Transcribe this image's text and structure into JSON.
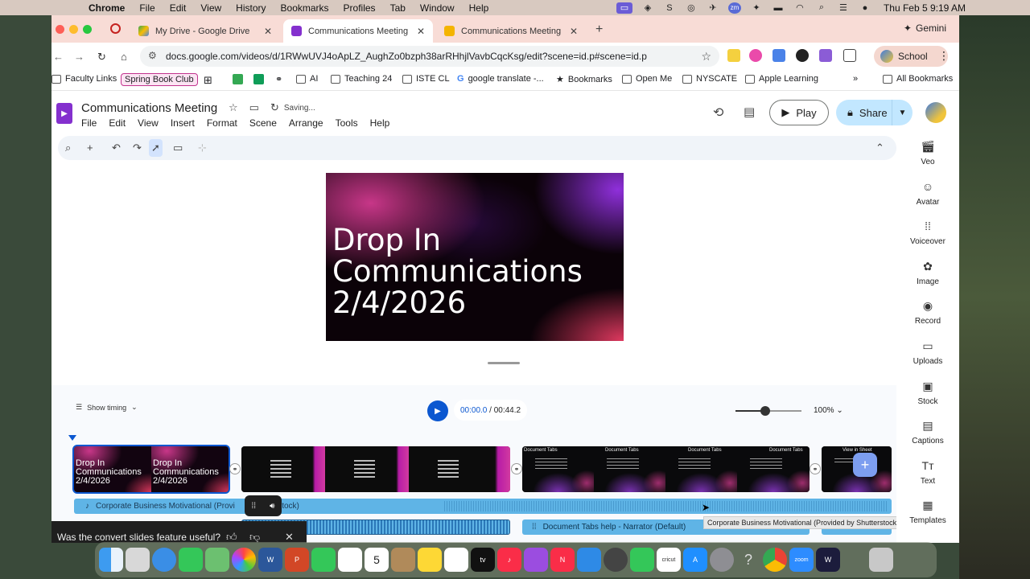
{
  "menubar": {
    "app": "Chrome",
    "menus": [
      "File",
      "Edit",
      "View",
      "History",
      "Bookmarks",
      "Profiles",
      "Tab",
      "Window",
      "Help"
    ],
    "clock": "Thu Feb 5  9:19 AM"
  },
  "tabs": [
    {
      "title": "My Drive - Google Drive",
      "color": "#34a853"
    },
    {
      "title": "Communications Meeting - G",
      "color": "#8430ce"
    },
    {
      "title": "Communications Meeting - G",
      "color": "#f4b400"
    }
  ],
  "gemini_label": "Gemini",
  "url": "docs.google.com/videos/d/1RWwUVJ4oApLZ_AughZo0bzph38arRHhjlVavbCqcKsg/edit?scene=id.p#scene=id.p",
  "profile_label": "School",
  "bookmarks": {
    "items": [
      "Faculty Links",
      "Spring Book Club",
      "AI",
      "Teaching 24",
      "ISTE CL",
      "google translate -...",
      "Bookmarks",
      "Open Me",
      "NYSCATE",
      "Apple Learning"
    ],
    "all_label": "All Bookmarks"
  },
  "doc": {
    "title": "Communications Meeting",
    "status": "Saving...",
    "menu": [
      "File",
      "Edit",
      "View",
      "Insert",
      "Format",
      "Scene",
      "Arrange",
      "Tools",
      "Help"
    ],
    "play_label": "Play",
    "share_label": "Share"
  },
  "slide": {
    "text": "Drop In\nCommunications\n2/4/2026"
  },
  "timeline": {
    "show_timing": "Show timing",
    "current_time": "00:00.0",
    "total_time": "/ 00:44.2",
    "zoom": "100%",
    "title_clip_text": "Drop In\nCommunications\n2/4/2026",
    "doc_tabs_label": "Document Tabs",
    "last_clip_label": "View in Sheet",
    "music_track": "Corporate Business Motivational (Provided by Shutterstock)",
    "music_track_visible": "Corporate Business Motivational (Provi",
    "music_track_tail": "rstock)",
    "narrator_clip": "Document Tabs help - Narrator (Default)",
    "tooltip": "Corporate Business Motivational (Provided by Shutterstock)"
  },
  "feedback": {
    "question": "Was the convert slides feature useful?"
  },
  "sidepanel": [
    "Veo",
    "Avatar",
    "Voiceover",
    "Image",
    "Record",
    "Uploads",
    "Stock",
    "Captions",
    "Text",
    "Templates"
  ],
  "colors": {
    "accent": "#0b57d0",
    "share_bg": "#c2e7ff",
    "track_blue": "#5fb4e6",
    "vids_purple": "#8430ce"
  }
}
